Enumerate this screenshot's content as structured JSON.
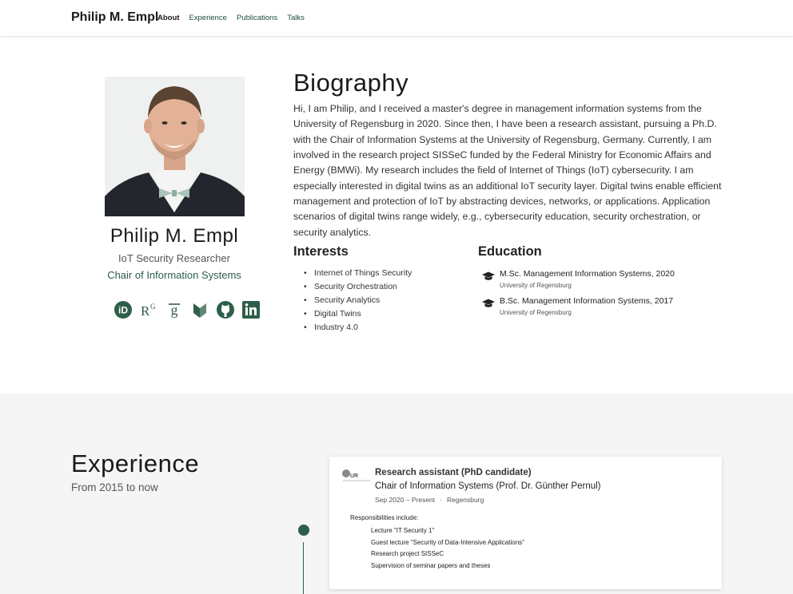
{
  "nav": {
    "brand": "Philip M. Empl",
    "links": [
      "About",
      "Experience",
      "Publications",
      "Talks"
    ]
  },
  "profile": {
    "name": "Philip M. Empl",
    "role": "IoT Security Researcher",
    "organization": "Chair of Information Systems",
    "social_icons": [
      "orcid-icon",
      "researchgate-icon",
      "google-scholar-icon",
      "dblp-icon",
      "github-icon",
      "linkedin-icon"
    ]
  },
  "biography": {
    "title": "Biography",
    "text": "Hi, I am Philip, and I received a master's degree in management information systems from the University of Regensburg in 2020. Since then, I have been a research assistant, pursuing a Ph.D. with the Chair of Information Systems at the University of Regensburg, Germany. Currently, I am involved in the research project SISSeC funded by the Federal Ministry for Economic Affairs and Energy (BMWi). My research includes the field of Internet of Things (IoT) cybersecurity. I am especially interested in digital twins as an additional IoT security layer. Digital twins enable efficient management and protection of IoT by abstracting devices, networks, or applications. Application scenarios of digital twins range widely, e.g., cybersecurity education, security orchestration, or security analytics."
  },
  "interests": {
    "title": "Interests",
    "items": [
      "Internet of Things Security",
      "Security Orchestration",
      "Security Analytics",
      "Digital Twins",
      "Industry 4.0"
    ]
  },
  "education": {
    "title": "Education",
    "items": [
      {
        "degree": "M.Sc. Management Information Systems, 2020",
        "institution": "University of Regensburg"
      },
      {
        "degree": "B.Sc. Management Information Systems, 2017",
        "institution": "University of Regensburg"
      }
    ]
  },
  "experience": {
    "title": "Experience",
    "subtitle": "From 2015 to now",
    "card": {
      "logo_text": "UR",
      "role": "Research assistant (PhD candidate)",
      "organization": "Chair of Information Systems (Prof. Dr. Günther Pernul)",
      "dates": "Sep 2020 – Present",
      "separator": "·",
      "location": "Regensburg",
      "responsibilities_title": "Responsibilities include:",
      "responsibilities": [
        "Lecture \"IT Security 1\"",
        "Guest lecture \"Security of Data-Intensive Applications\"",
        "Research project SISSeC",
        "Supervision of seminar papers and theses"
      ]
    }
  },
  "colors": {
    "accent": "#2d5f48",
    "section_bg": "#f5f5f5",
    "text": "#222222"
  }
}
